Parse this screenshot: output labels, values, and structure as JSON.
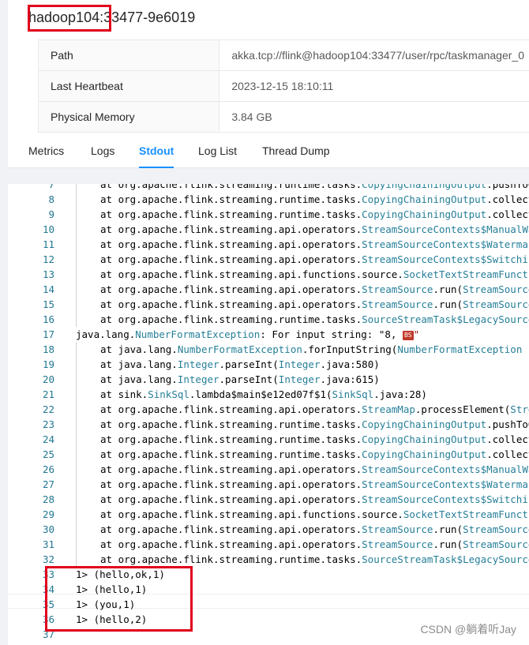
{
  "taskmanager": {
    "title": "hadoop104:33477-9e6019",
    "info": [
      {
        "key": "Path",
        "value": "akka.tcp://flink@hadoop104:33477/user/rpc/taskmanager_0"
      },
      {
        "key": "Last Heartbeat",
        "value": "2023-12-15 18:10:11"
      },
      {
        "key": "Physical Memory",
        "value": "3.84 GB"
      }
    ]
  },
  "tabs": [
    "Metrics",
    "Logs",
    "Stdout",
    "Log List",
    "Thread Dump"
  ],
  "active_tab": "Stdout",
  "stdout": {
    "lines": [
      {
        "n": "7",
        "indent": true,
        "parts": [
          [
            "at org.apache.flink.streaming.runtime.tasks.",
            ""
          ],
          [
            "CopyingChainingOutput",
            "t"
          ],
          [
            ".pushToOperator(",
            ""
          ]
        ]
      },
      {
        "n": "8",
        "indent": true,
        "parts": [
          [
            "at org.apache.flink.streaming.runtime.tasks.",
            ""
          ],
          [
            "CopyingChainingOutput",
            "t"
          ],
          [
            ".collect(",
            ""
          ]
        ]
      },
      {
        "n": "9",
        "indent": true,
        "parts": [
          [
            "at org.apache.flink.streaming.runtime.tasks.",
            ""
          ],
          [
            "CopyingChainingOutput",
            "t"
          ],
          [
            ".collect(",
            ""
          ]
        ]
      },
      {
        "n": "10",
        "indent": true,
        "parts": [
          [
            "at org.apache.flink.streaming.api.operators.",
            ""
          ],
          [
            "StreamSourceContexts$ManualWatermarkContext",
            "t"
          ]
        ]
      },
      {
        "n": "11",
        "indent": true,
        "parts": [
          [
            "at org.apache.flink.streaming.api.operators.",
            ""
          ],
          [
            "StreamSourceContexts$WatermarkContext",
            "t"
          ]
        ]
      },
      {
        "n": "12",
        "indent": true,
        "parts": [
          [
            "at org.apache.flink.streaming.api.operators.",
            ""
          ],
          [
            "StreamSourceContexts$SwitchingOnClose",
            "t"
          ]
        ]
      },
      {
        "n": "13",
        "indent": true,
        "parts": [
          [
            "at org.apache.flink.streaming.api.functions.source.",
            ""
          ],
          [
            "SocketTextStreamFunction",
            "t"
          ]
        ]
      },
      {
        "n": "14",
        "indent": true,
        "parts": [
          [
            "at org.apache.flink.streaming.api.operators.",
            ""
          ],
          [
            "StreamSource",
            "t"
          ],
          [
            ".run(",
            ""
          ],
          [
            "StreamSource",
            "t"
          ]
        ]
      },
      {
        "n": "15",
        "indent": true,
        "parts": [
          [
            "at org.apache.flink.streaming.api.operators.",
            ""
          ],
          [
            "StreamSource",
            "t"
          ],
          [
            ".run(",
            ""
          ],
          [
            "StreamSource",
            "t"
          ]
        ]
      },
      {
        "n": "16",
        "indent": true,
        "parts": [
          [
            "at org.apache.flink.streaming.runtime.tasks.",
            ""
          ],
          [
            "SourceStreamTask$LegacySourceFunctionThread",
            "t"
          ]
        ]
      },
      {
        "n": "17",
        "indent": false,
        "parts": [
          [
            "java.lang.",
            ""
          ],
          [
            "NumberFormatException",
            "t"
          ],
          [
            ": For input string: \"8, ",
            ""
          ],
          [
            "BS",
            "err"
          ],
          [
            "\"",
            "s"
          ]
        ]
      },
      {
        "n": "18",
        "indent": true,
        "parts": [
          [
            "at java.lang.",
            ""
          ],
          [
            "NumberFormatException",
            "t"
          ],
          [
            ".forInputString(",
            ""
          ],
          [
            "NumberFormatException",
            "t"
          ]
        ]
      },
      {
        "n": "19",
        "indent": true,
        "parts": [
          [
            "at java.lang.",
            ""
          ],
          [
            "Integer",
            "t"
          ],
          [
            ".parseInt(",
            ""
          ],
          [
            "Integer",
            "t"
          ],
          [
            ".java:580)",
            ""
          ]
        ]
      },
      {
        "n": "20",
        "indent": true,
        "parts": [
          [
            "at java.lang.",
            ""
          ],
          [
            "Integer",
            "t"
          ],
          [
            ".parseInt(",
            ""
          ],
          [
            "Integer",
            "t"
          ],
          [
            ".java:615)",
            ""
          ]
        ]
      },
      {
        "n": "21",
        "indent": true,
        "parts": [
          [
            "at sink.",
            ""
          ],
          [
            "SinkSql",
            "t"
          ],
          [
            ".lambda$main$e12ed07f$1(",
            ""
          ],
          [
            "SinkSql",
            "t"
          ],
          [
            ".java:28)",
            ""
          ]
        ]
      },
      {
        "n": "22",
        "indent": true,
        "parts": [
          [
            "at org.apache.flink.streaming.api.operators.",
            ""
          ],
          [
            "StreamMap",
            "t"
          ],
          [
            ".processElement(",
            ""
          ],
          [
            "StreamMap",
            "t"
          ]
        ]
      },
      {
        "n": "23",
        "indent": true,
        "parts": [
          [
            "at org.apache.flink.streaming.runtime.tasks.",
            ""
          ],
          [
            "CopyingChainingOutput",
            "t"
          ],
          [
            ".pushToOperator(",
            ""
          ]
        ]
      },
      {
        "n": "24",
        "indent": true,
        "parts": [
          [
            "at org.apache.flink.streaming.runtime.tasks.",
            ""
          ],
          [
            "CopyingChainingOutput",
            "t"
          ],
          [
            ".collect(",
            ""
          ]
        ]
      },
      {
        "n": "25",
        "indent": true,
        "parts": [
          [
            "at org.apache.flink.streaming.runtime.tasks.",
            ""
          ],
          [
            "CopyingChainingOutput",
            "t"
          ],
          [
            ".collect(",
            ""
          ]
        ]
      },
      {
        "n": "26",
        "indent": true,
        "parts": [
          [
            "at org.apache.flink.streaming.api.operators.",
            ""
          ],
          [
            "StreamSourceContexts$ManualWatermarkContext",
            "t"
          ]
        ]
      },
      {
        "n": "27",
        "indent": true,
        "parts": [
          [
            "at org.apache.flink.streaming.api.operators.",
            ""
          ],
          [
            "StreamSourceContexts$WatermarkContext",
            "t"
          ]
        ]
      },
      {
        "n": "28",
        "indent": true,
        "parts": [
          [
            "at org.apache.flink.streaming.api.operators.",
            ""
          ],
          [
            "StreamSourceContexts$SwitchingOnClose",
            "t"
          ]
        ]
      },
      {
        "n": "29",
        "indent": true,
        "parts": [
          [
            "at org.apache.flink.streaming.api.functions.source.",
            ""
          ],
          [
            "SocketTextStreamFunction",
            "t"
          ]
        ]
      },
      {
        "n": "30",
        "indent": true,
        "parts": [
          [
            "at org.apache.flink.streaming.api.operators.",
            ""
          ],
          [
            "StreamSource",
            "t"
          ],
          [
            ".run(",
            ""
          ],
          [
            "StreamSource",
            "t"
          ]
        ]
      },
      {
        "n": "31",
        "indent": true,
        "parts": [
          [
            "at org.apache.flink.streaming.api.operators.",
            ""
          ],
          [
            "StreamSource",
            "t"
          ],
          [
            ".run(",
            ""
          ],
          [
            "StreamSource",
            "t"
          ]
        ]
      },
      {
        "n": "32",
        "indent": true,
        "parts": [
          [
            "at org.apache.flink.streaming.runtime.tasks.",
            ""
          ],
          [
            "SourceStreamTask$LegacySourceFunctionThread",
            "t"
          ]
        ]
      },
      {
        "n": "33",
        "indent": false,
        "parts": [
          [
            "1> (hello,ok,1)",
            ""
          ]
        ]
      },
      {
        "n": "34",
        "indent": false,
        "parts": [
          [
            "1> (hello,1)",
            ""
          ]
        ]
      },
      {
        "n": "35",
        "indent": false,
        "parts": [
          [
            "1> (you,1)",
            ""
          ]
        ]
      },
      {
        "n": "36",
        "indent": false,
        "parts": [
          [
            "1> (hello,2)",
            ""
          ]
        ]
      },
      {
        "n": "37",
        "indent": false,
        "parts": []
      }
    ]
  },
  "watermark": "CSDN @躺着听Jay",
  "colors": {
    "accent": "#1890ff",
    "highlight_box": "#e0001b",
    "type_token": "#267f99",
    "line_number": "#237893"
  }
}
